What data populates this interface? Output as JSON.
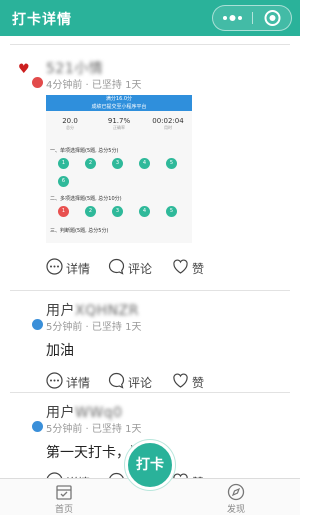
{
  "header": {
    "title": "打卡详情",
    "more_icon": "more-dots-icon",
    "close_icon": "target-circle-icon"
  },
  "posts": [
    {
      "username_visible": "",
      "username_blurred": "521小情",
      "meta": "4分钟前 · 已坚持 1天",
      "badge_color": "#e24b4b",
      "liked_marker": "♥",
      "screenshot": {
        "header_text": "满分16.0分",
        "header_sub": "成绩已提交至小程序平台",
        "stats": [
          {
            "value": "20.0",
            "label": "总分"
          },
          {
            "value": "91.7%",
            "label": "正确率"
          },
          {
            "value": "00:02:04",
            "label": "用时"
          }
        ],
        "sections": [
          "一、单项选择题(5题, 总分5分)",
          "二、多项选择题(5题, 总分10分)",
          "三、判断题(5题, 总分5分)"
        ],
        "row1": [
          "1",
          "2",
          "3",
          "4",
          "5"
        ],
        "row1b": [
          "6"
        ],
        "row2": [
          "1",
          "2",
          "3",
          "4",
          "5"
        ]
      },
      "actions": {
        "detail": "详情",
        "comment": "评论",
        "like": "赞"
      }
    },
    {
      "username_visible": "用户",
      "username_blurred": "XQHNZR",
      "meta": "5分钟前 · 已坚持 1天",
      "badge_color": "#3a8fd9",
      "content": "加油",
      "actions": {
        "detail": "详情",
        "comment": "评论",
        "like": "赞"
      }
    },
    {
      "username_visible": "用户",
      "username_blurred": "WWq0",
      "meta": "5分钟前 · 已坚持 1天",
      "badge_color": "#3a8fd9",
      "content": "第一天打卡，激动！",
      "actions": {
        "detail": "详情",
        "comment": "评论",
        "like": "赞"
      }
    }
  ],
  "tabbar": {
    "home": "首页",
    "checkin": "打卡",
    "discover": "发现"
  },
  "colors": {
    "accent": "#2ab29a",
    "liked": "#cc1f1f",
    "wrong": "#e8504f"
  }
}
